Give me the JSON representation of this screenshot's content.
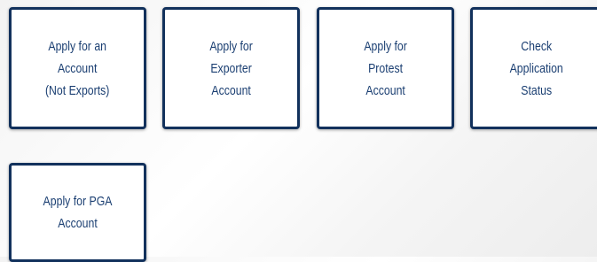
{
  "tiles": [
    {
      "label": "Apply for an\nAccount\n(Not Exports)"
    },
    {
      "label": "Apply for\nExporter\nAccount"
    },
    {
      "label": "Apply for\nProtest\nAccount"
    },
    {
      "label": "Check\nApplication\nStatus"
    },
    {
      "label": "Apply for PGA\nAccount"
    }
  ],
  "colors": {
    "tile_border": "#12315c",
    "tile_text": "#1b3f72",
    "tile_background": "#ffffff"
  }
}
